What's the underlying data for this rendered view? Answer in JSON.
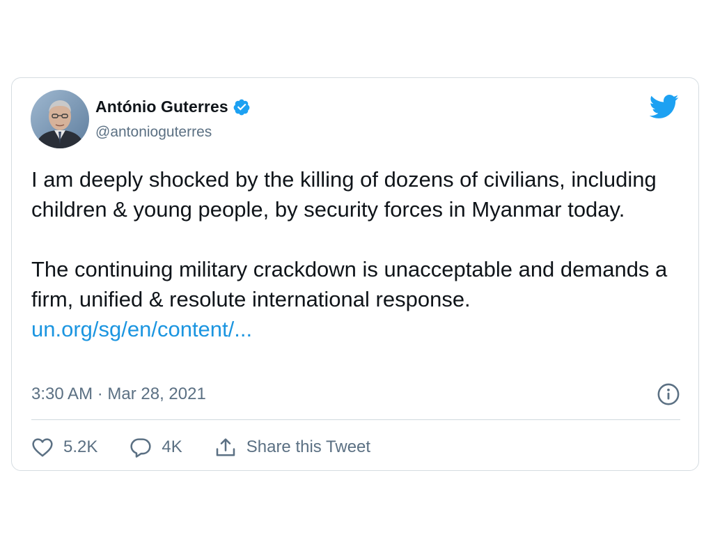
{
  "tweet": {
    "author": {
      "display_name": "António Guterres",
      "handle": "@antonioguterres",
      "verified": true
    },
    "paragraphs": [
      "I am deeply shocked by the killing of dozens of civilians, including children & young people, by security forces in Myanmar today.",
      "The continuing military crackdown is unacceptable and demands a firm, unified & resolute international response."
    ],
    "link_text": "un.org/sg/en/content/...",
    "timestamp": "3:30 AM · Mar 28, 2021",
    "actions": {
      "likes": "5.2K",
      "replies": "4K",
      "share_label": "Share this Tweet"
    }
  },
  "icons": {
    "brand": "twitter-bird-icon",
    "verified": "verified-badge-icon",
    "info": "info-icon",
    "like": "heart-icon",
    "reply": "speech-bubble-icon",
    "share": "share-upload-icon"
  },
  "colors": {
    "brand_blue": "#1da1f2",
    "link_blue": "#1b95e0",
    "secondary_text": "#5b7083",
    "primary_text": "#0f1419",
    "border": "#d5dce1"
  }
}
